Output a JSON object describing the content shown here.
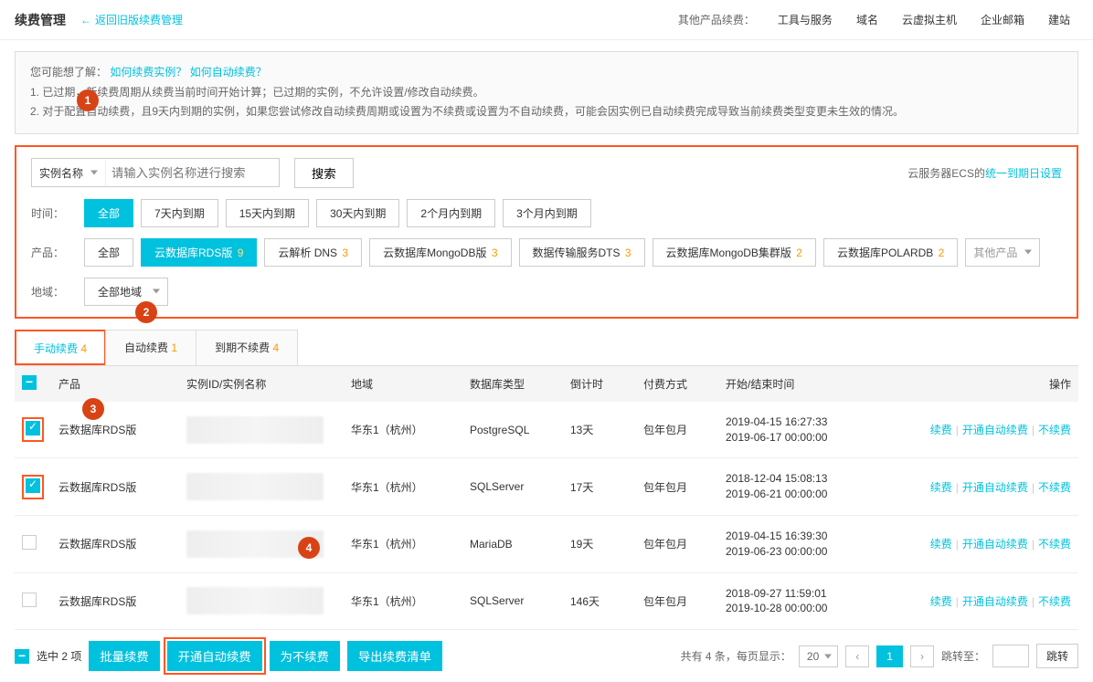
{
  "header": {
    "title": "续费管理",
    "back": "返回旧版续费管理",
    "rightLabel": "其他产品续费：",
    "rightTabs": [
      "工具与服务",
      "域名",
      "云虚拟主机",
      "企业邮箱",
      "建站"
    ]
  },
  "notice": {
    "intro": "您可能想了解：",
    "link1": "如何续费实例？",
    "link2": "如何自动续费？",
    "line1": "1. 已过期，新续费周期从续费当前时间开始计算；已过期的实例，不允许设置/修改自动续费。",
    "line2": "2. 对于配置自动续费，且9天内到期的实例，如果您尝试修改自动续费周期或设置为不续费或设置为不自动续费，可能会因实例已自动续费完成导致当前续费类型变更未生效的情况。"
  },
  "filter": {
    "searchTypeLabel": "实例名称",
    "searchPlaceholder": "请输入实例名称进行搜索",
    "searchBtn": "搜索",
    "ecsLabel": "云服务器ECS的",
    "ecsLink": "统一到期日设置",
    "timeLabel": "时间：",
    "timeOptions": [
      "全部",
      "7天内到期",
      "15天内到期",
      "30天内到期",
      "2个月内到期",
      "3个月内到期"
    ],
    "productLabel": "产品：",
    "products": [
      {
        "name": "全部",
        "count": ""
      },
      {
        "name": "云数据库RDS版",
        "count": "9"
      },
      {
        "name": "云解析 DNS",
        "count": "3"
      },
      {
        "name": "云数据库MongoDB版",
        "count": "3"
      },
      {
        "name": "数据传输服务DTS",
        "count": "3"
      },
      {
        "name": "云数据库MongoDB集群版",
        "count": "2"
      },
      {
        "name": "云数据库POLARDB",
        "count": "2"
      }
    ],
    "otherProduct": "其他产品",
    "regionLabel": "地域：",
    "regionValue": "全部地域"
  },
  "tabs": [
    {
      "label": "手动续费",
      "count": "4"
    },
    {
      "label": "自动续费",
      "count": "1"
    },
    {
      "label": "到期不续费",
      "count": "4"
    }
  ],
  "table": {
    "headers": {
      "product": "产品",
      "instance": "实例ID/实例名称",
      "region": "地域",
      "dbtype": "数据库类型",
      "countdown": "倒计时",
      "payment": "付费方式",
      "time": "开始/结束时间",
      "action": "操作"
    },
    "rows": [
      {
        "checked": true,
        "product": "云数据库RDS版",
        "region": "华东1（杭州）",
        "dbtype": "PostgreSQL",
        "countdown": "13天",
        "payment": "包年包月",
        "start": "2019-04-15 16:27:33",
        "end": "2019-06-17 00:00:00"
      },
      {
        "checked": true,
        "product": "云数据库RDS版",
        "region": "华东1（杭州）",
        "dbtype": "SQLServer",
        "countdown": "17天",
        "payment": "包年包月",
        "start": "2018-12-04 15:08:13",
        "end": "2019-06-21 00:00:00"
      },
      {
        "checked": false,
        "product": "云数据库RDS版",
        "region": "华东1（杭州）",
        "dbtype": "MariaDB",
        "countdown": "19天",
        "payment": "包年包月",
        "start": "2019-04-15 16:39:30",
        "end": "2019-06-23 00:00:00"
      },
      {
        "checked": false,
        "product": "云数据库RDS版",
        "region": "华东1（杭州）",
        "dbtype": "SQLServer",
        "countdown": "146天",
        "payment": "包年包月",
        "start": "2018-09-27 11:59:01",
        "end": "2019-10-28 00:00:00"
      }
    ],
    "actions": {
      "renew": "续费",
      "auto": "开通自动续费",
      "no": "不续费"
    }
  },
  "footer": {
    "selected": "选中 2 项",
    "batchRenew": "批量续费",
    "batchAuto": "开通自动续费",
    "batchNo": "为不续费",
    "export": "导出续费清单",
    "total": "共有 4 条，每页显示：",
    "pageSize": "20",
    "currentPage": "1",
    "jumpLabel": "跳转至：",
    "jumpBtn": "跳转"
  },
  "badges": {
    "b1": "1",
    "b2": "2",
    "b3": "3",
    "b4": "4"
  }
}
